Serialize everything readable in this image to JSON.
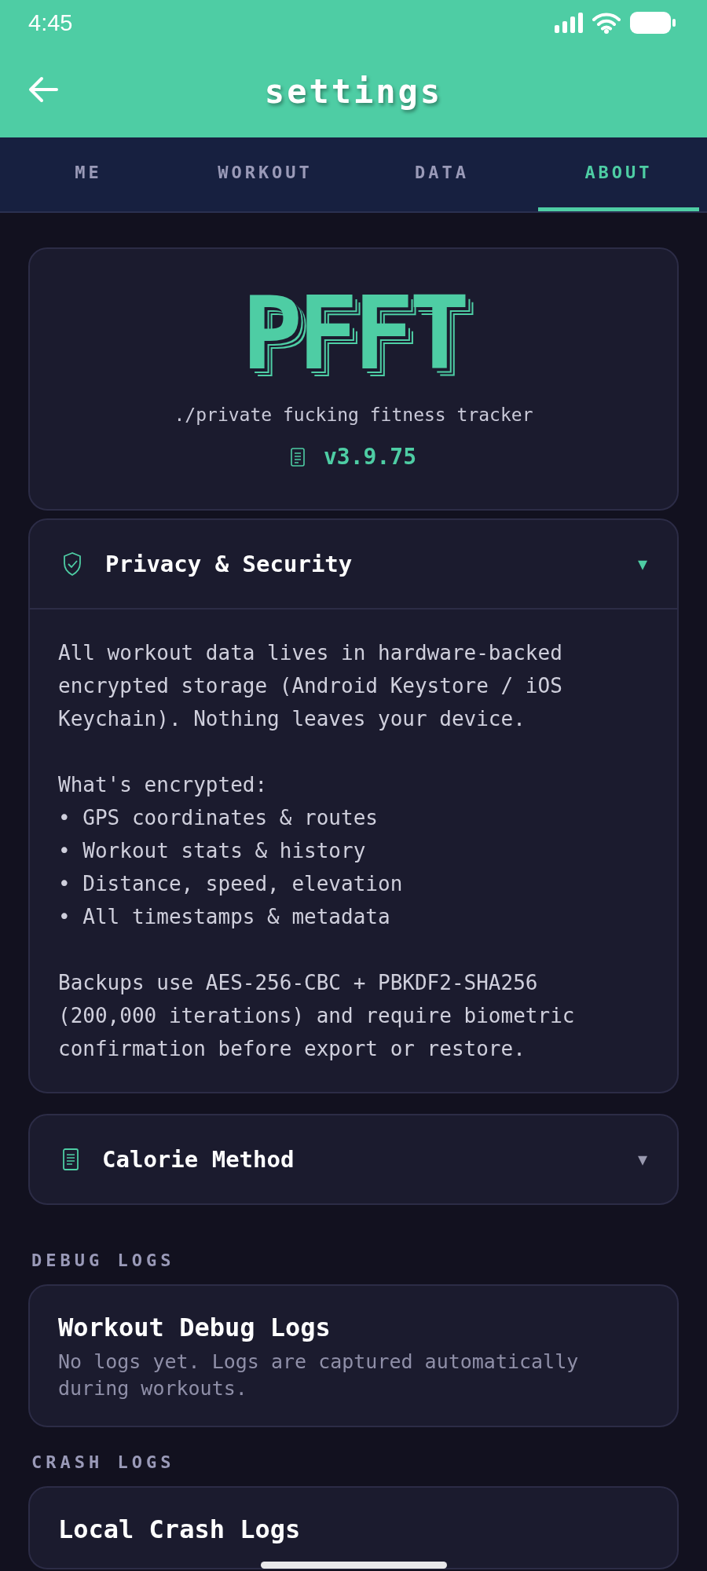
{
  "status_bar": {
    "time": "4:45"
  },
  "header": {
    "title": "settings"
  },
  "tabs": [
    {
      "label": "ME",
      "selected": false
    },
    {
      "label": "WORKOUT",
      "selected": false
    },
    {
      "label": "DATA",
      "selected": false
    },
    {
      "label": "ABOUT",
      "selected": true
    }
  ],
  "about_card": {
    "logo": "PFFT",
    "tagline": "./private fucking fitness tracker",
    "version": "v3.9.75"
  },
  "sections": [
    {
      "kind": "accordion",
      "title": "Privacy & Security",
      "chevron": "▼",
      "expanded": true,
      "body": [
        {
          "kind": "paragraph",
          "text": "All workout data lives in hardware-backed encrypted storage (Android Keystore / iOS Keychain). Nothing leaves your device."
        },
        {
          "kind": "list",
          "heading": "What's encrypted:",
          "items": [
            "• GPS coordinates & routes",
            "• Workout stats & history",
            "• Distance, speed, elevation",
            "• All timestamps & metadata"
          ]
        },
        {
          "kind": "paragraph",
          "text": "Backups use AES-256-CBC + PBKDF2-SHA256 (200,000 iterations) and require biometric confirmation before export or restore."
        }
      ]
    },
    {
      "kind": "accordion",
      "title": "Calorie Method",
      "chevron": "▼",
      "expanded": false
    },
    {
      "kind": "group",
      "label": "DEBUG LOGS",
      "card": {
        "title": "Workout Debug Logs",
        "text": "No logs yet. Logs are captured automatically during workouts."
      }
    },
    {
      "kind": "group",
      "label": "CRASH LOGS",
      "card": {
        "title": "Local Crash Logs"
      }
    }
  ]
}
